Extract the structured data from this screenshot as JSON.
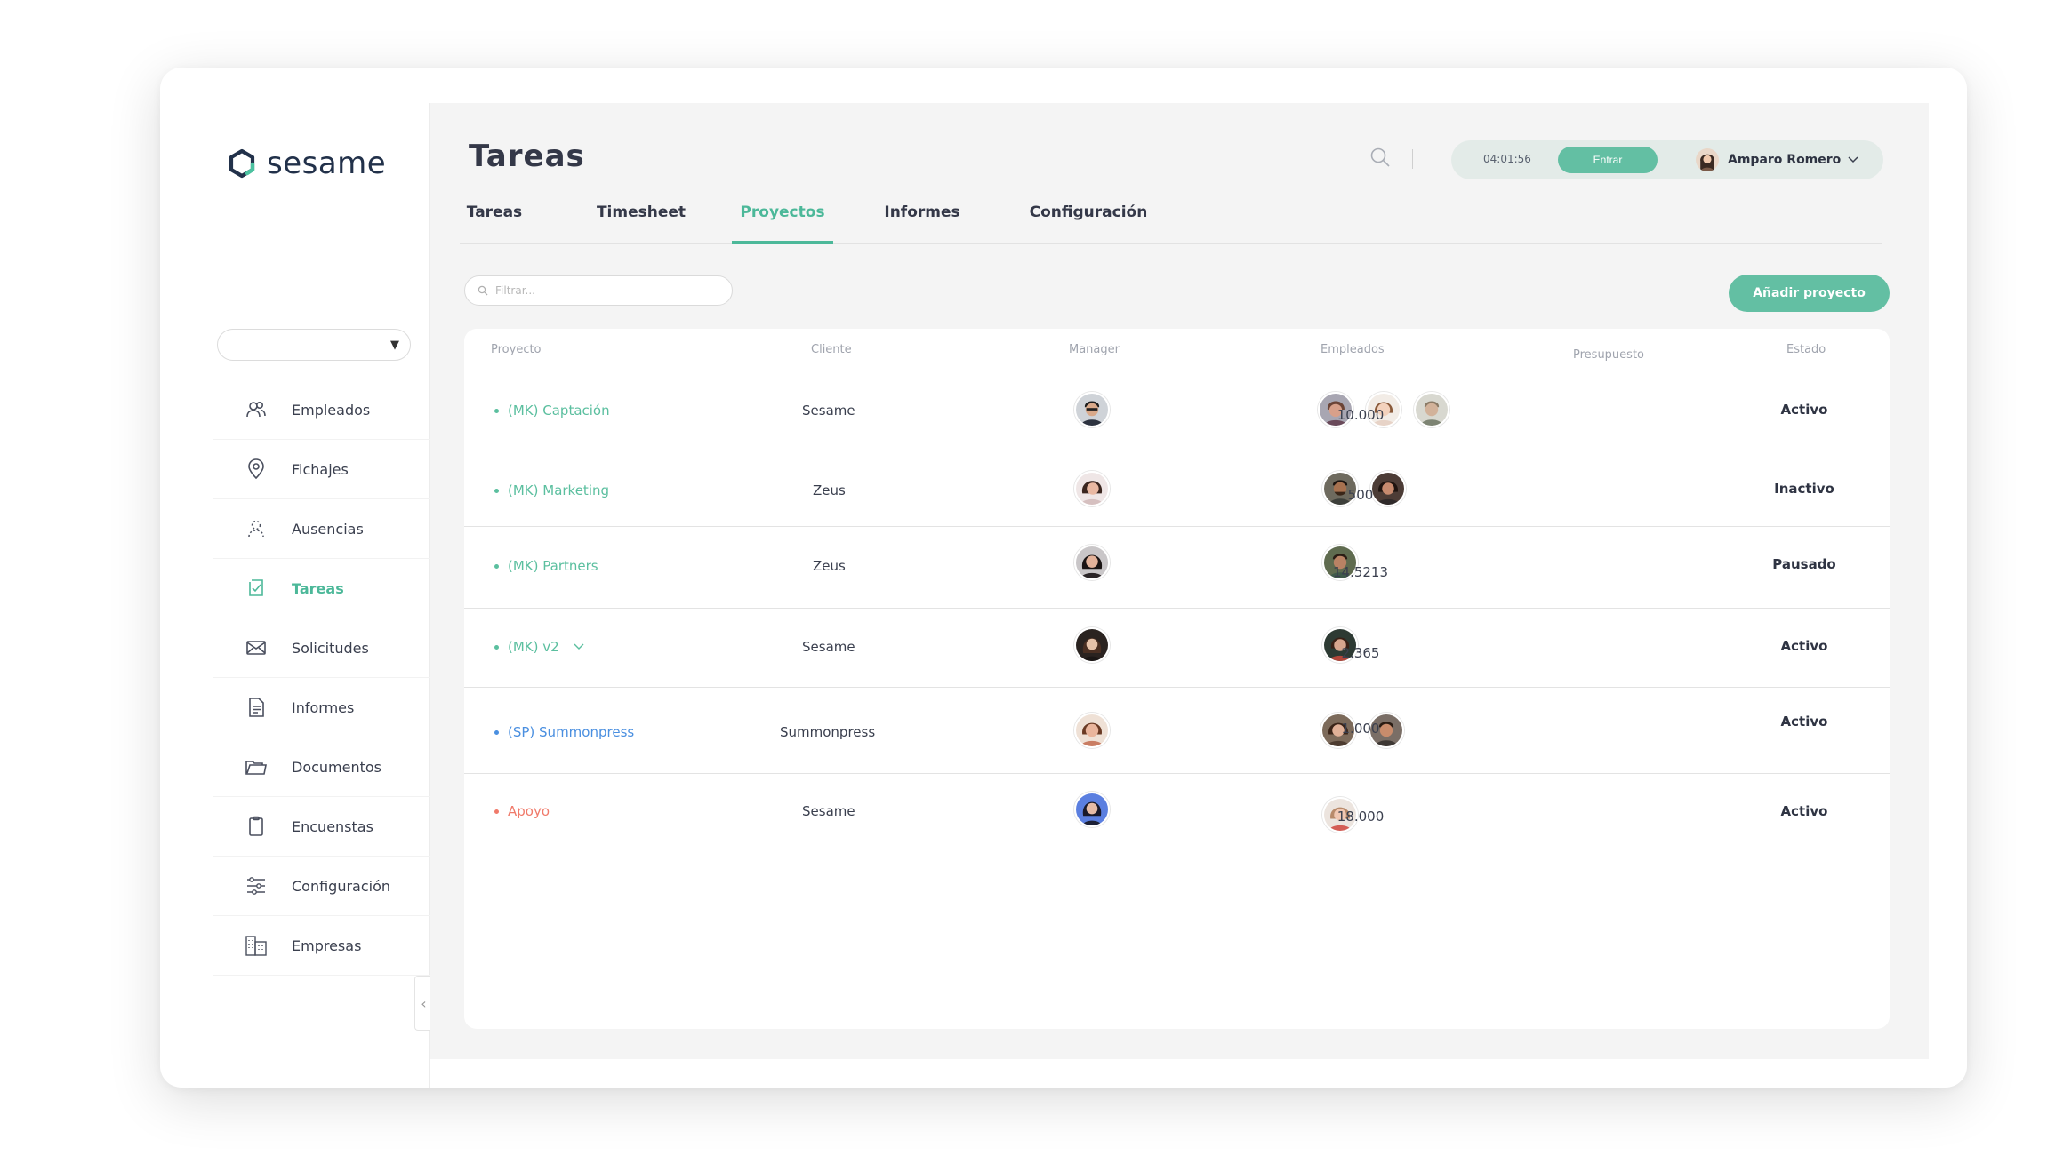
{
  "app": {
    "logo_text": "sesame",
    "page_title": "Tareas"
  },
  "sidebar": {
    "items": [
      {
        "label": "Empleados",
        "icon": "users-icon",
        "active": false
      },
      {
        "label": "Fichajes",
        "icon": "location-pin-icon",
        "active": false
      },
      {
        "label": "Ausencias",
        "icon": "absence-icon",
        "active": false
      },
      {
        "label": "Tareas",
        "icon": "tasks-icon",
        "active": true
      },
      {
        "label": "Solicitudes",
        "icon": "envelope-icon",
        "active": false
      },
      {
        "label": "Informes",
        "icon": "document-icon",
        "active": false
      },
      {
        "label": "Documentos",
        "icon": "folder-icon",
        "active": false
      },
      {
        "label": "Encuenstas",
        "icon": "clipboard-icon",
        "active": false
      },
      {
        "label": "Configuración",
        "icon": "sliders-icon",
        "active": false
      },
      {
        "label": "Empresas",
        "icon": "building-icon",
        "active": false
      }
    ]
  },
  "header": {
    "clock": "04:01:56",
    "enter_label": "Entrar",
    "user_name": "Amparo Romero"
  },
  "tabs": [
    {
      "label": "Tareas",
      "active": false
    },
    {
      "label": "Timesheet",
      "active": false
    },
    {
      "label": "Proyectos",
      "active": true
    },
    {
      "label": "Informes",
      "active": false
    },
    {
      "label": "Configuración",
      "active": false
    }
  ],
  "filter": {
    "placeholder": "Filtrar..."
  },
  "add_project_label": "Añadir proyecto",
  "table": {
    "columns": [
      "Proyecto",
      "Cliente",
      "Manager",
      "Empleados",
      "Presupuesto",
      "Estado"
    ],
    "rows": [
      {
        "project": "(MK) Captación",
        "project_color": "#5bbf9f",
        "client": "Sesame",
        "budget": "10.000",
        "status": "Activo",
        "employees": 3,
        "expandable": false
      },
      {
        "project": "(MK) Marketing",
        "project_color": "#5bbf9f",
        "client": "Zeus",
        "budget": "500",
        "status": "Inactivo",
        "employees": 2,
        "expandable": false
      },
      {
        "project": "(MK) Partners",
        "project_color": "#5bbf9f",
        "client": "Zeus",
        "budget": "14.5213",
        "status": "Pausado",
        "employees": 1,
        "expandable": false
      },
      {
        "project": "(MK) v2",
        "project_color": "#5bbf9f",
        "client": "Sesame",
        "budget": "2.365",
        "status": "Activo",
        "employees": 1,
        "expandable": true
      },
      {
        "project": "(SP) Summonpress",
        "project_color": "#4a8fe0",
        "client": "Summonpress",
        "budget": "1.000",
        "status": "Activo",
        "employees": 2,
        "expandable": false
      },
      {
        "project": "Apoyo",
        "project_color": "#f07a6a",
        "client": "Sesame",
        "budget": "18.000",
        "status": "Activo",
        "employees": 1,
        "expandable": false
      }
    ]
  },
  "colors": {
    "accent": "#63bfa3",
    "accent_text": "#4cb899",
    "blue": "#4a8fe0",
    "coral": "#f07a6a"
  }
}
